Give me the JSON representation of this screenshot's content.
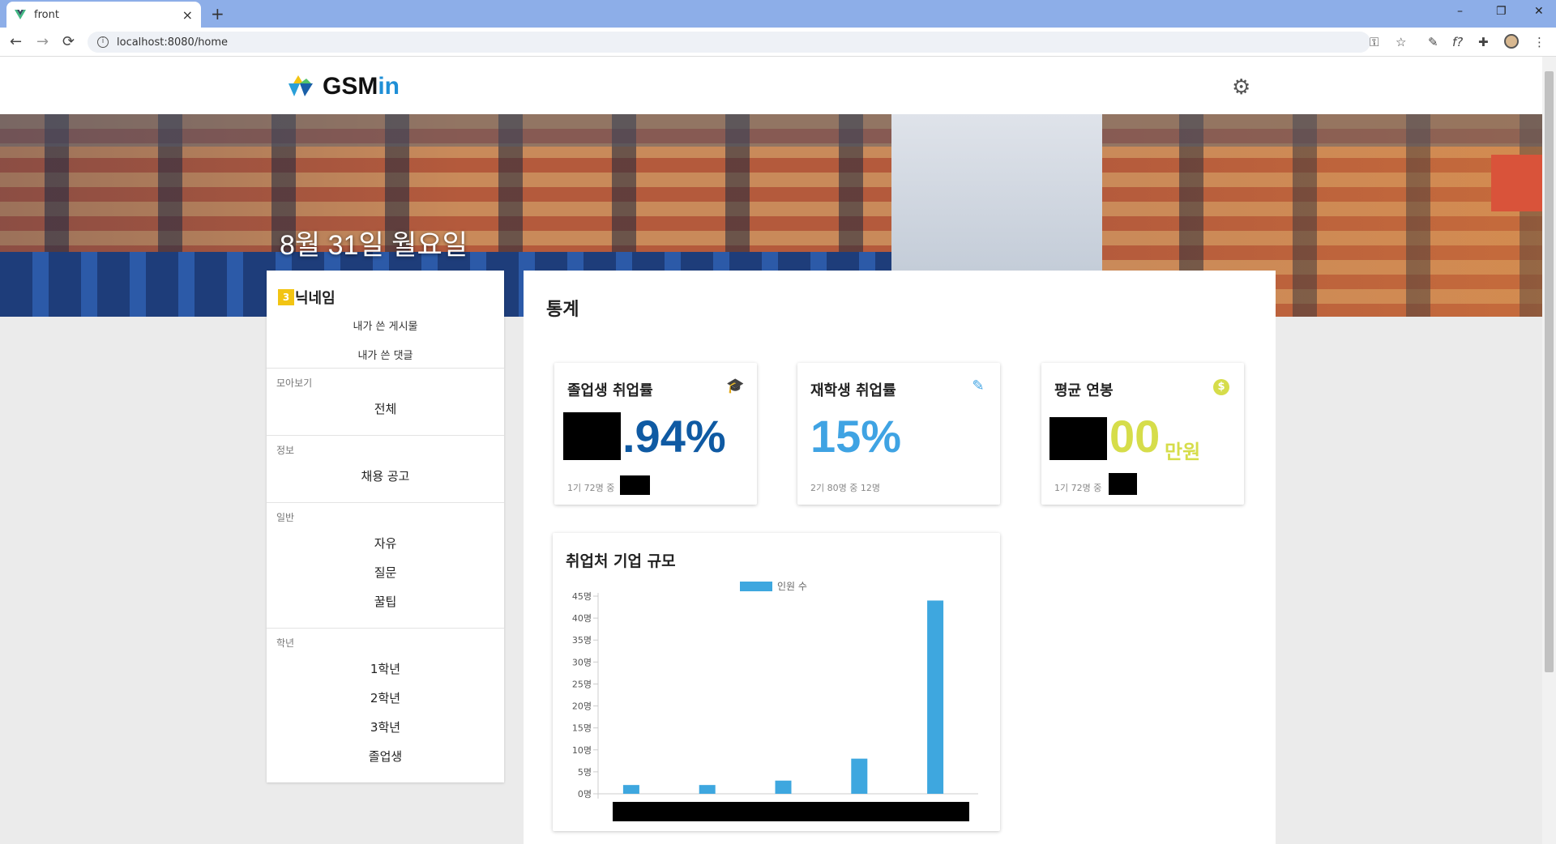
{
  "browser": {
    "tab_title": "front",
    "tab_close": "×",
    "new_tab": "+",
    "url": "localhost:8080/home",
    "win_minimize": "–",
    "win_restore": "❐",
    "win_close": "✕",
    "back": "←",
    "forward": "→",
    "reload": "⟳",
    "toolbar_icons": [
      "key-icon",
      "star-icon",
      "eyedropper-icon",
      "formula-icon",
      "puzzle-icon",
      "profile-avatar",
      "kebab-menu-icon"
    ]
  },
  "header": {
    "logo_text_1": "GSM",
    "logo_text_2": "in",
    "settings_icon": "gear-icon",
    "brand_color": "#1f8fd6"
  },
  "banner": {
    "date": "8월 31일 월요일"
  },
  "sidebar": {
    "grade_badge": "3",
    "username": "닉네임",
    "links": [
      "내가 쓴 게시물",
      "내가 쓴 댓글"
    ],
    "sections": [
      {
        "label": "모아보기",
        "items": [
          "전체"
        ]
      },
      {
        "label": "정보",
        "items": [
          "채용 공고"
        ]
      },
      {
        "label": "일반",
        "items": [
          "자유",
          "질문",
          "꿀팁"
        ]
      },
      {
        "label": "학년",
        "items": [
          "1학년",
          "2학년",
          "3학년",
          "졸업생"
        ]
      }
    ]
  },
  "stats": {
    "title": "통계",
    "cards": [
      {
        "title": "졸업생 취업률",
        "icon": "graduation-cap-icon",
        "value_suffix": ".94%",
        "sub": "1기 72명 중",
        "color": "#0f5aa3"
      },
      {
        "title": "재학생 취업률",
        "icon": "pencil-icon",
        "value": "15%",
        "sub": "2기 80명 중 12명",
        "color": "#3fa3e3"
      },
      {
        "title": "평균 연봉",
        "icon": "dollar-coin-icon",
        "value_suffix": "00",
        "unit": "만원",
        "sub": "1기 72명 중",
        "color": "#d6dd4a"
      }
    ]
  },
  "chart_data": {
    "type": "bar",
    "title": "취업처 기업 규모",
    "legend": [
      "인원 수"
    ],
    "legend_position": "top-center",
    "series": [
      {
        "name": "인원 수",
        "values": [
          2,
          2,
          3,
          8,
          44
        ]
      }
    ],
    "categories": [
      "",
      "",
      "",
      "",
      ""
    ],
    "y_ticks": [
      "0명",
      "5명",
      "10명",
      "15명",
      "20명",
      "25명",
      "30명",
      "35명",
      "40명",
      "45명"
    ],
    "ylim": [
      0,
      45
    ],
    "bar_color": "#3ea7df"
  }
}
